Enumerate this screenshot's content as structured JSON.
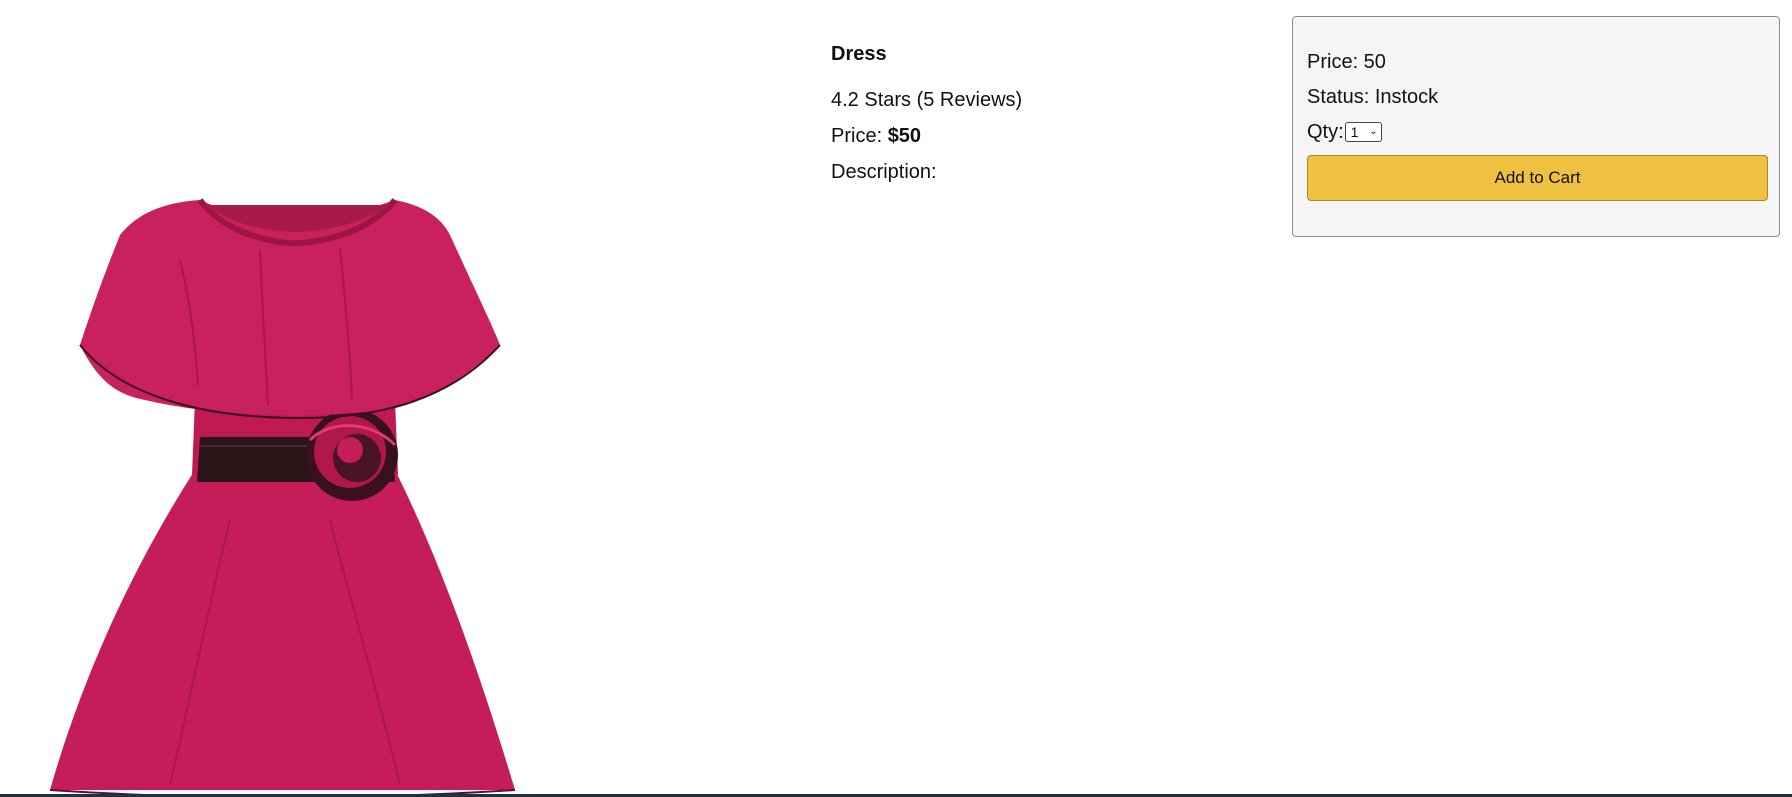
{
  "product": {
    "name": "Dress",
    "rating_text": "4.2 Stars (5 Reviews)",
    "price_label": "Price: ",
    "price_value": "$50",
    "description_label": "Description:",
    "image": "dress-photo"
  },
  "purchase_box": {
    "price_line": "Price: 50",
    "status_line": "Status: Instock",
    "qty_label": "Qty:",
    "qty_selected": "1",
    "add_to_cart_label": "Add to Cart"
  },
  "colors": {
    "button": "#f0c040",
    "box_background": "#f5f5f5",
    "dress": "#c51d5a",
    "belt": "#2a1418",
    "bottom_strip": "#203040"
  }
}
